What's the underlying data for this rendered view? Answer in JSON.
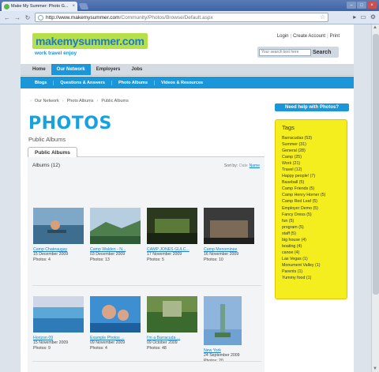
{
  "browser": {
    "tab_title": "Make My Summer: Photo G...",
    "tab_close": "×",
    "url_host": "http://www.makemysummer.com",
    "url_path": "/Community/Photos/Browse/Default.aspx"
  },
  "header": {
    "brand": "makemysummer.com",
    "tagline": "work travel enjoy",
    "login": "Login",
    "create_account": "Create Account",
    "print": "Print",
    "separator": "|",
    "search_placeholder": "Your search text here",
    "search_button": "Search"
  },
  "main_nav": [
    "Home",
    "Our Network",
    "Employers",
    "Jobs"
  ],
  "sub_nav": [
    "Blogs",
    "Questions & Answers",
    "Photo Albums",
    "Videos & Resources"
  ],
  "breadcrumb": [
    "Our Network",
    "Photo Albums",
    "Public Albums"
  ],
  "page_title": "PHOTOS",
  "subtitle": "Public Albums",
  "tab_public_albums": "Public Albums",
  "albums_count": "Albums (12)",
  "sort": {
    "label": "Sort by:",
    "date": "Date",
    "name": "Name"
  },
  "albums": [
    {
      "name": "Camp Chateaugay",
      "date": "15 December 2009",
      "count": "Photos: 4",
      "colors": [
        "#7fa7c8",
        "#3d6e8f",
        "#2a4c60"
      ]
    },
    {
      "name": "Camp Walden - N...",
      "date": "03 December 2009",
      "count": "Photos: 13",
      "colors": [
        "#b7cde0",
        "#4e7d4e",
        "#2e5a36"
      ]
    },
    {
      "name": "CAMP JONES GULC...",
      "date": "17 November 2009",
      "count": "Photos: 5",
      "colors": [
        "#2b3a1e",
        "#5b7a3a",
        "#1a2412"
      ]
    },
    {
      "name": "Camp Menominee",
      "date": "16 November 2009",
      "count": "Photos: 10",
      "colors": [
        "#3a3a3a",
        "#7a6a56",
        "#1f1f1f"
      ]
    },
    {
      "name": "Horizon 09",
      "date": "15 November 2009",
      "count": "Photos: 9",
      "colors": [
        "#cfd7e6",
        "#5aa7d8",
        "#2f7bb8"
      ]
    },
    {
      "name": "Example Photos ...",
      "date": "09 November 2009",
      "count": "Photos: 4",
      "colors": [
        "#3d8fd1",
        "#d9a58a",
        "#1e5f9e"
      ]
    },
    {
      "name": "I'm a Barracuda ...",
      "date": "09 October 2009",
      "count": "Photos: 48",
      "colors": [
        "#6e8f4a",
        "#3a6a2e",
        "#a8b88c"
      ]
    },
    {
      "name": "New York",
      "date": "24 September 2009",
      "count": "Photos: 20",
      "colors": [
        "#8fb5dc",
        "#6fa1d2",
        "#4a7a4e"
      ]
    }
  ],
  "help_button": "Need help with Photos?",
  "tags_title": "Tags",
  "tags": [
    "Barracudas (53)",
    "Summer (31)",
    "General (28)",
    "Camp (25)",
    "Work (21)",
    "Travel (12)",
    "Happy people! (7)",
    "Baseball (5)",
    "Camp Friends (5)",
    "Camp Henry Horner (5)",
    "Camp Red Leaf (5)",
    "Employer Demo (5)",
    "Fancy Dress (5)",
    "fun (5)",
    "program (5)",
    "staff (5)",
    "big house (4)",
    "boating (4)",
    "canoe (4)",
    "Las Vegas (1)",
    "Monument Valley (1)",
    "Parents (1)",
    "Yummy food (1)"
  ]
}
